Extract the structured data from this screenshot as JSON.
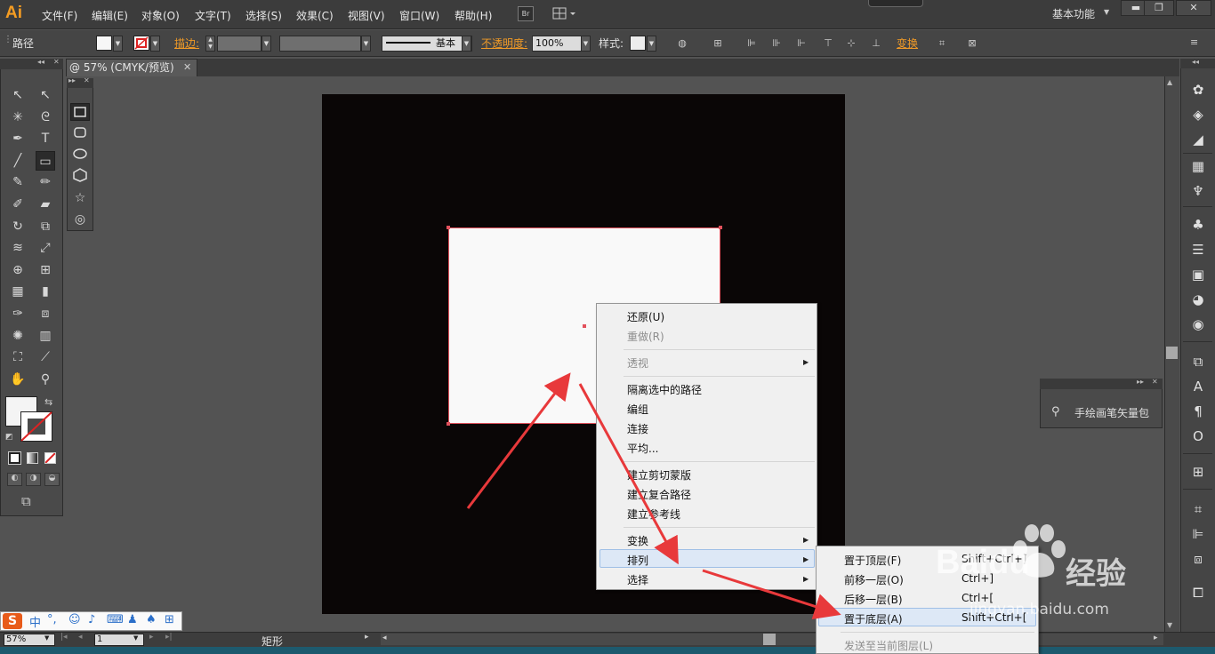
{
  "app": {
    "logo": "Ai",
    "workspace": "基本功能"
  },
  "menubar": {
    "items": [
      "文件(F)",
      "编辑(E)",
      "对象(O)",
      "文字(T)",
      "选择(S)",
      "效果(C)",
      "视图(V)",
      "窗口(W)",
      "帮助(H)"
    ],
    "bridge": "Br"
  },
  "window_controls": {
    "minimize": "▬",
    "restore": "❐",
    "close": "✕"
  },
  "control_bar": {
    "selection_label": "路径",
    "stroke_label": "描边:",
    "stroke_profile": "基本",
    "opacity_label": "不透明度:",
    "opacity_value": "100%",
    "style_label": "样式:",
    "transform_label": "变换"
  },
  "document": {
    "tab_title": "@ 57% (CMYK/预览)",
    "tab_close": "✕"
  },
  "tools": [
    "selection-tool",
    "direct-selection-tool",
    "magic-wand-tool",
    "lasso-tool",
    "pen-tool",
    "type-tool",
    "line-tool",
    "rectangle-tool",
    "paintbrush-tool",
    "pencil-tool",
    "blob-brush-tool",
    "eraser-tool",
    "rotate-tool",
    "scale-tool",
    "warp-tool",
    "free-transform-tool",
    "shape-builder-tool",
    "perspective-grid-tool",
    "mesh-tool",
    "gradient-tool",
    "eyedropper-tool",
    "blend-tool",
    "symbol-sprayer-tool",
    "column-graph-tool",
    "artboard-tool",
    "slice-tool",
    "hand-tool",
    "zoom-tool"
  ],
  "brush_panel": {
    "label": "手绘画笔矢量包"
  },
  "context_menu": {
    "items": [
      {
        "label": "还原(U)",
        "disabled": false
      },
      {
        "label": "重做(R)",
        "disabled": true
      },
      {
        "label": "透视",
        "disabled": true,
        "submenu": true
      },
      {
        "label": "隔离选中的路径",
        "disabled": false
      },
      {
        "label": "编组",
        "disabled": false
      },
      {
        "label": "连接",
        "disabled": false
      },
      {
        "label": "平均...",
        "disabled": false
      },
      {
        "label": "建立剪切蒙版",
        "disabled": false
      },
      {
        "label": "建立复合路径",
        "disabled": false
      },
      {
        "label": "建立参考线",
        "disabled": false
      },
      {
        "label": "变换",
        "disabled": false,
        "submenu": true
      },
      {
        "label": "排列",
        "disabled": false,
        "submenu": true,
        "highlighted": true
      },
      {
        "label": "选择",
        "disabled": false,
        "submenu": true
      }
    ]
  },
  "arrange_submenu": {
    "items": [
      {
        "label": "置于顶层(F)",
        "shortcut": "Shift+Ctrl+]"
      },
      {
        "label": "前移一层(O)",
        "shortcut": "Ctrl+]"
      },
      {
        "label": "后移一层(B)",
        "shortcut": "Ctrl+["
      },
      {
        "label": "置于底层(A)",
        "shortcut": "Shift+Ctrl+[",
        "highlighted": true
      },
      {
        "label": "发送至当前图层(L)",
        "shortcut": "",
        "disabled": true
      }
    ]
  },
  "statusbar": {
    "zoom": "57%",
    "page": "1",
    "status": "矩形"
  },
  "ime": {
    "logo": "S",
    "mode": "中"
  },
  "watermark": {
    "brand": "Baidu",
    "brand_cn": "经验",
    "url": "jingyan.baidu.com"
  },
  "colors": {
    "accent_orange": "#f09a27",
    "selection_red": "#e2515c",
    "annotation_arrow": "#e8393b",
    "artboard": "#0a0606",
    "menu_highlight": "#dde8f6"
  }
}
